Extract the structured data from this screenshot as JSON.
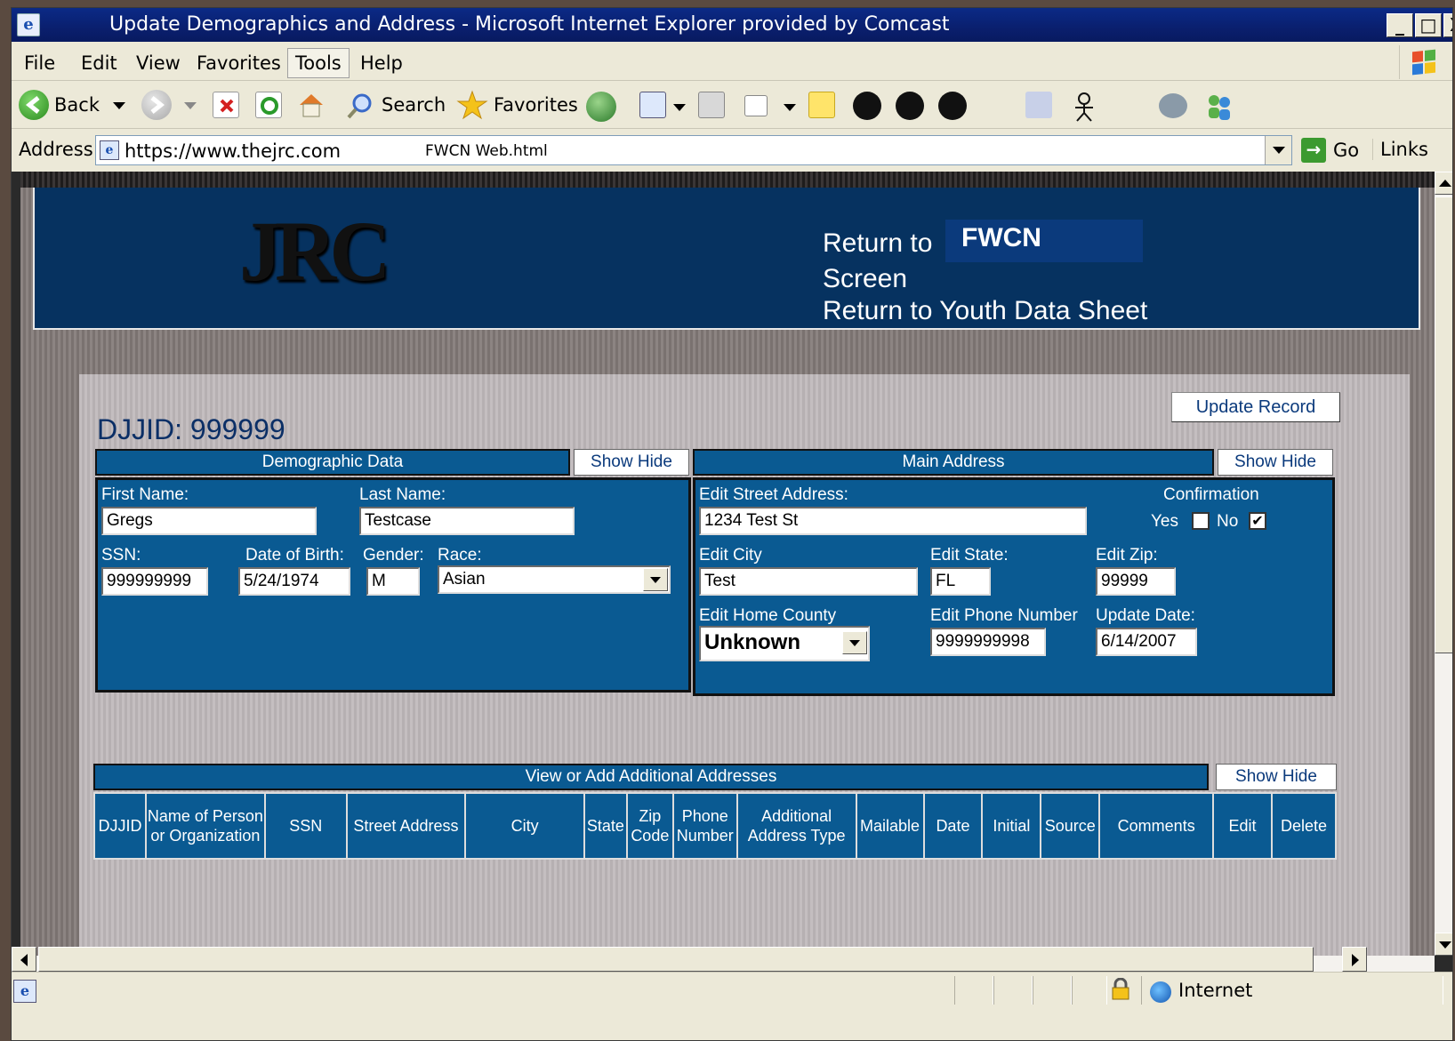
{
  "window": {
    "title": "Update Demographics and Address - Microsoft Internet Explorer provided by Comcast",
    "controls": {
      "minimize": "_",
      "maximize": "□",
      "close": "X"
    }
  },
  "menubar": {
    "items": [
      "File",
      "Edit",
      "View",
      "Favorites",
      "Tools",
      "Help"
    ],
    "active": "Tools"
  },
  "toolbar": {
    "back_label": "Back",
    "search_label": "Search",
    "favorites_label": "Favorites"
  },
  "addressbar": {
    "label": "Address",
    "url": "https://www.thejrc.com",
    "file": "FWCN Web.html",
    "go_label": "Go",
    "links_label": "Links"
  },
  "banner": {
    "logo_text": "JRC",
    "return_to": "Return to",
    "fwcn": "FWCN",
    "screen": "Screen",
    "return_youth": "Return to Youth Data Sheet",
    "banner_color": "#063260"
  },
  "main": {
    "djjid_title": "DJJID: 999999",
    "update_record_label": "Update Record",
    "show_hide_label": "Show Hide"
  },
  "demographics": {
    "header": "Demographic Data",
    "first_name_label": "First Name:",
    "first_name": "Gregs",
    "last_name_label": "Last Name:",
    "last_name": "Testcase",
    "ssn_label": "SSN:",
    "ssn": "999999999",
    "dob_label": "Date of Birth:",
    "dob": "5/24/1974",
    "gender_label": "Gender:",
    "gender": "M",
    "race_label": "Race:",
    "race": "Asian"
  },
  "main_address": {
    "header": "Main Address",
    "street_label": "Edit Street Address:",
    "street": "1234 Test St",
    "confirmation_label": "Confirmation",
    "yes_label": "Yes",
    "no_label": "No",
    "yes_checked": false,
    "no_checked": true,
    "city_label": "Edit City",
    "city": "Test",
    "state_label": "Edit State:",
    "state": "FL",
    "zip_label": "Edit Zip:",
    "zip": "99999",
    "county_label": "Edit Home County",
    "county": "Unknown",
    "phone_label": "Edit Phone Number",
    "phone": "9999999998",
    "update_date_label": "Update Date:",
    "update_date": "6/14/2007"
  },
  "additional": {
    "header": "View or Add Additional Addresses",
    "columns": [
      "DJJID",
      "Name of Person or Organization",
      "SSN",
      "Street Address",
      "City",
      "State",
      "Zip Code",
      "Phone Number",
      "Additional Address Type",
      "Mailable",
      "Date",
      "Initial",
      "Source",
      "Comments",
      "Edit",
      "Delete"
    ]
  },
  "statusbar": {
    "zone": "Internet"
  },
  "colors": {
    "panel_blue": "#0a5a92",
    "title_blue": "#0b2f66"
  }
}
